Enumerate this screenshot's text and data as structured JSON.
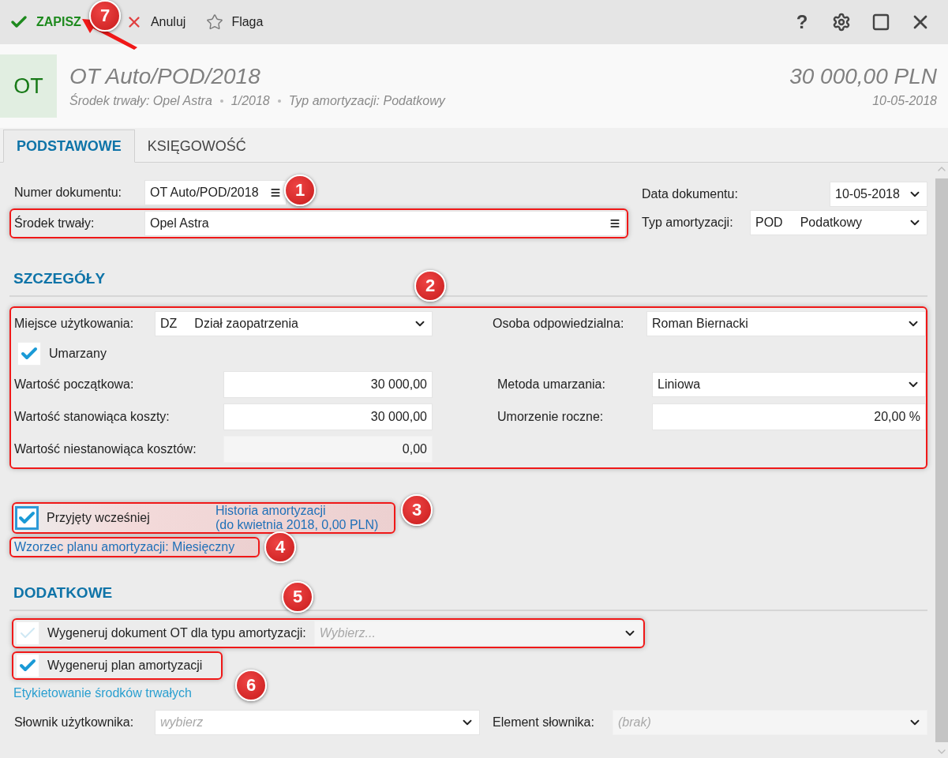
{
  "toolbar": {
    "actions": [
      {
        "kind": "save",
        "label": "ZAPISZ"
      },
      {
        "kind": "cancel",
        "label": "Anuluj"
      },
      {
        "kind": "flag",
        "label": "Flaga"
      }
    ],
    "window_controls": [
      {
        "kind": "help",
        "label": "?"
      },
      {
        "kind": "settings"
      },
      {
        "kind": "maximize"
      },
      {
        "kind": "close"
      }
    ]
  },
  "header": {
    "badge": "OT",
    "title": "OT Auto/POD/2018",
    "meta": [
      "Środek trwały: Opel Astra",
      "1/2018",
      "Typ amortyzacji: Podatkowy"
    ],
    "amount": "30 000,00 PLN",
    "date": "10-05-2018"
  },
  "tabs": [
    {
      "label": "PODSTAWOWE",
      "selected": true
    },
    {
      "label": "KSIĘGOWOŚĆ",
      "selected": false
    }
  ],
  "document": {
    "number": {
      "label": "Numer dokumentu:",
      "value": "OT Auto/POD/2018"
    },
    "date": {
      "label": "Data dokumentu:",
      "value": "10-05-2018"
    },
    "asset": {
      "label": "Środek trwały:",
      "value": "Opel Astra"
    },
    "depreciation_type": {
      "label": "Typ amortyzacji:",
      "code": "POD",
      "value": "Podatkowy"
    }
  },
  "details": {
    "heading": "SZCZEGÓŁY",
    "location": {
      "label": "Miejsce użytkowania:",
      "code": "DZ",
      "value": "Dział zaopatrzenia"
    },
    "responsible": {
      "label": "Osoba odpowiedzialna:",
      "value": "Roman Biernacki"
    },
    "depreciated": {
      "label": "Umarzany",
      "checked": true
    },
    "values": [
      {
        "label": "Wartość początkowa:",
        "value": "30 000,00",
        "disabled": false
      },
      {
        "label": "Wartość stanowiąca koszty:",
        "value": "30 000,00",
        "disabled": false
      },
      {
        "label": "Wartość niestanowiąca kosztów:",
        "value": "0,00",
        "disabled": true
      }
    ],
    "method": {
      "label": "Metoda umarzania:",
      "value": "Liniowa"
    },
    "annual_rate": {
      "label": "Umorzenie roczne:",
      "value": "20,00 %"
    }
  },
  "history": {
    "accepted_earlier": {
      "label": "Przyjęty wcześniej",
      "checked": true,
      "focused": true
    },
    "link_lines": [
      "Historia amortyzacji",
      "(do kwietnia 2018, 0,00 PLN)"
    ],
    "plan_template": "Wzorzec planu amortyzacji: Miesięczny"
  },
  "additional": {
    "heading": "DODATKOWE",
    "generate_ot": {
      "label": "Wygeneruj dokument OT dla typu amortyzacji:",
      "checked": false,
      "placeholder": "Wybierz..."
    },
    "generate_plan": {
      "label": "Wygeneruj plan amortyzacji",
      "checked": true
    },
    "labeling_link": "Etykietowanie środków trwałych",
    "user_dictionary": {
      "label": "Słownik użytkownika:",
      "placeholder": "wybierz",
      "disabled": false
    },
    "dictionary_element": {
      "label": "Element słownika:",
      "placeholder": "(brak)",
      "disabled": true
    }
  },
  "callouts": [
    {
      "number": "1"
    },
    {
      "number": "2"
    },
    {
      "number": "3"
    },
    {
      "number": "4"
    },
    {
      "number": "5"
    },
    {
      "number": "6"
    },
    {
      "number": "7"
    }
  ]
}
